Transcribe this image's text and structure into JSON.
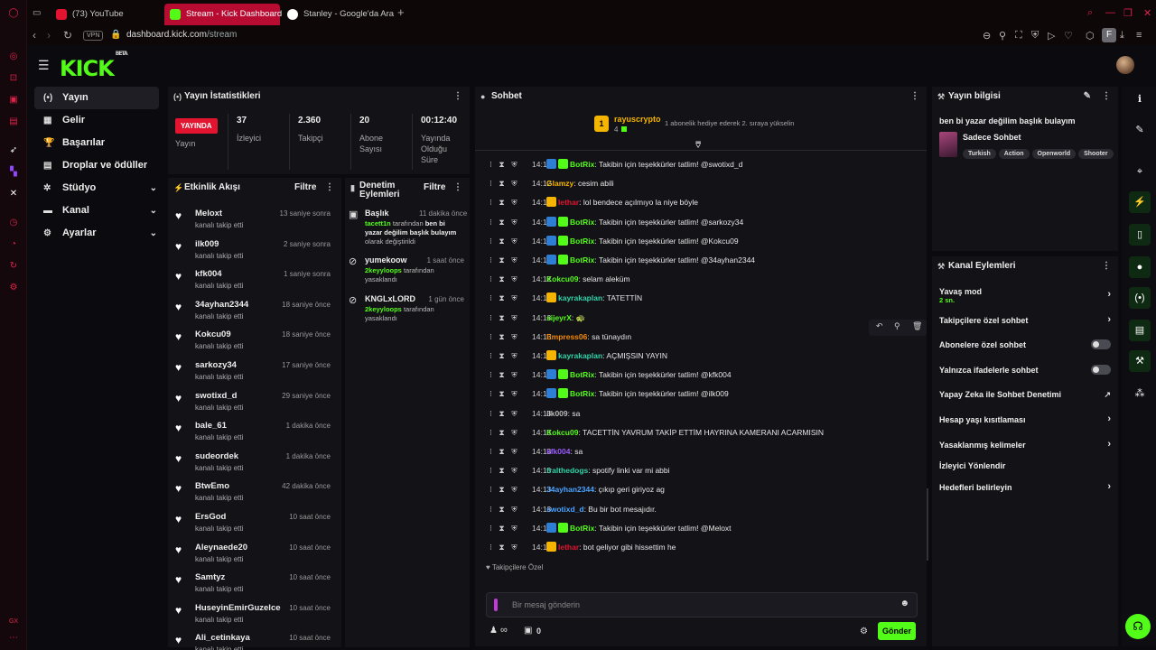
{
  "browser": {
    "tabs": [
      {
        "title": "(73) YouTube",
        "favicon": "youtube-icon"
      },
      {
        "title": "Stream - Kick Dashboard",
        "favicon": "kick-icon"
      },
      {
        "title": "Stanley - Google'da Ara",
        "favicon": "google-icon"
      }
    ],
    "vpn_label": "VPN",
    "url_host": "dashboard.kick.com",
    "url_path": "/stream",
    "profile_letter": "F",
    "accent": "#e0214a"
  },
  "app": {
    "logo": "KICK",
    "logo_sup": "BETA",
    "brand_color": "#53fc18"
  },
  "nav": {
    "items": [
      {
        "label": "Yayın",
        "icon": "stream-icon"
      },
      {
        "label": "Gelir",
        "icon": "revenue-icon"
      },
      {
        "label": "Başarılar",
        "icon": "trophy-icon"
      },
      {
        "label": "Droplar ve ödüller",
        "icon": "gift-icon"
      },
      {
        "label": "Stüdyo",
        "icon": "studio-icon"
      },
      {
        "label": "Kanal",
        "icon": "channel-icon"
      },
      {
        "label": "Ayarlar",
        "icon": "settings-icon"
      }
    ]
  },
  "stats": {
    "title": "Yayın İstatistikleri",
    "live_badge": "YAYINDA",
    "live_label": "Yayın",
    "items": [
      {
        "value": "37",
        "label": "İzleyici"
      },
      {
        "value": "2.360",
        "label": "Takipçi"
      },
      {
        "value": "20",
        "label": "Abone Sayısı"
      },
      {
        "value": "00:12:40",
        "label": "Yayında Olduğu Süre"
      }
    ]
  },
  "activity": {
    "title": "Etkinlik Akışı",
    "filter": "Filtre",
    "subtitle": "kanalı takip etti",
    "items": [
      {
        "name": "Meloxt",
        "time": "13 saniye sonra"
      },
      {
        "name": "ilk009",
        "time": "2 saniye sonra"
      },
      {
        "name": "kfk004",
        "time": "1 saniye sonra"
      },
      {
        "name": "34ayhan2344",
        "time": "18 saniye önce"
      },
      {
        "name": "Kokcu09",
        "time": "18 saniye önce"
      },
      {
        "name": "sarkozy34",
        "time": "17 saniye önce"
      },
      {
        "name": "swotixd_d",
        "time": "29 saniye önce"
      },
      {
        "name": "bale_61",
        "time": "1 dakika önce"
      },
      {
        "name": "sudeordek",
        "time": "1 dakika önce"
      },
      {
        "name": "BtwEmo",
        "time": "42 dakika önce"
      },
      {
        "name": "ErsGod",
        "time": "10 saat önce"
      },
      {
        "name": "Aleynaede20",
        "time": "10 saat önce"
      },
      {
        "name": "Samtyz",
        "time": "10 saat önce"
      },
      {
        "name": "HuseyinEmirGuzelce",
        "time": "10 saat önce"
      },
      {
        "name": "Ali_cetinkaya",
        "time": "10 saat önce"
      }
    ]
  },
  "moderation": {
    "title_line1": "Denetim",
    "title_line2": "Eylemleri",
    "filter": "Filtre",
    "items": [
      {
        "title": "Başlık",
        "time": "11 dakika önce",
        "actor": "tacett1n",
        "desc_a": " tarafından ",
        "desc_b": "ben bi yazar değilim başlık bulayım",
        "desc_c": " olarak değiştirildi"
      },
      {
        "title": "yumekoow",
        "time": "1 saat önce",
        "actor": "2keyyloops",
        "desc_a": " tarafından ",
        "desc_b": "",
        "desc_c": "yasaklandı"
      },
      {
        "title": "KNGLxLORD",
        "time": "1 gün önce",
        "actor": "2keyyloops",
        "desc_a": " tarafından ",
        "desc_b": "",
        "desc_c": "yasaklandı"
      }
    ]
  },
  "chat": {
    "title": "Sohbet",
    "pinned_user": "rayuscrypto",
    "pinned_count": "4",
    "pinned_rank": "1",
    "pinned_text": "1 abonelik hediye ederek 2. sıraya yükselin",
    "messages": [
      {
        "time": "14:12",
        "user": "BotRix",
        "color": "#53fc18",
        "badges": [
          "bot",
          "verified"
        ],
        "text": "Takibin için teşekkürler tatlim! @swotixd_d"
      },
      {
        "time": "14:12",
        "user": "Glamzy",
        "color": "#f5b400",
        "badges": [],
        "text": "cesim abili"
      },
      {
        "time": "14:12",
        "user": "lethar",
        "color": "#e3142f",
        "badges": [
          "crown"
        ],
        "text": "lol bendece açılmıyo la niye böyle"
      },
      {
        "time": "14:12",
        "user": "BotRix",
        "color": "#53fc18",
        "badges": [
          "bot",
          "verified"
        ],
        "text": "Takibin için teşekkürler tatlim! @sarkozy34"
      },
      {
        "time": "14:12",
        "user": "BotRix",
        "color": "#53fc18",
        "badges": [
          "bot",
          "verified"
        ],
        "text": "Takibin için teşekkürler tatlim! @Kokcu09"
      },
      {
        "time": "14:12",
        "user": "BotRix",
        "color": "#53fc18",
        "badges": [
          "bot",
          "verified"
        ],
        "text": "Takibin için teşekkürler tatlim! @34ayhan2344"
      },
      {
        "time": "14:12",
        "user": "Kokcu09",
        "color": "#53fc18",
        "badges": [],
        "text": "selam aleküm"
      },
      {
        "time": "14:13",
        "user": "kayrakaplan",
        "color": "#2fd3a8",
        "badges": [
          "crown"
        ],
        "text": "TATETTİN"
      },
      {
        "time": "14:13",
        "user": "sijeyrX",
        "color": "#53fc18",
        "badges": [],
        "text": "🐢"
      },
      {
        "time": "14:13",
        "user": "Empress06",
        "color": "#f58a00",
        "badges": [],
        "text": "sa tünaydın"
      },
      {
        "time": "14:13",
        "user": "kayrakaplan",
        "color": "#2fd3a8",
        "badges": [
          "crown"
        ],
        "text": "AÇMIŞSIN YAYIN"
      },
      {
        "time": "14:13",
        "user": "BotRix",
        "color": "#53fc18",
        "badges": [
          "bot",
          "verified"
        ],
        "text": "Takibin için teşekkürler tatlim! @kfk004"
      },
      {
        "time": "14:13",
        "user": "BotRix",
        "color": "#53fc18",
        "badges": [
          "bot",
          "verified"
        ],
        "text": "Takibin için teşekkürler tatlim! @ilk009"
      },
      {
        "time": "14:13",
        "user": "ilk009",
        "color": "#bbbbbb",
        "badges": [],
        "text": "sa"
      },
      {
        "time": "14:13",
        "user": "Kokcu09",
        "color": "#53fc18",
        "badges": [],
        "text": "TACETTİN YAVRUM TAKİP ETTİM HAYRINA KAMERANI ACARMISIN"
      },
      {
        "time": "14:13",
        "user": "kfk004",
        "color": "#9b59ff",
        "badges": [],
        "text": "sa"
      },
      {
        "time": "14:13",
        "user": "fralthedogs",
        "color": "#2fd3a8",
        "badges": [],
        "text": "spotify linki var mi abbi"
      },
      {
        "time": "14:13",
        "user": "34ayhan2344",
        "color": "#4aa3ff",
        "badges": [],
        "text": "çıkıp geri giriyoz ag"
      },
      {
        "time": "14:13",
        "user": "swotixd_d",
        "color": "#4aa3ff",
        "badges": [],
        "text": "Bu bir bot mesajıdır."
      },
      {
        "time": "14:13",
        "user": "BotRix",
        "color": "#53fc18",
        "badges": [
          "bot",
          "verified"
        ],
        "text": "Takibin için teşekkürler tatlim! @Meloxt"
      },
      {
        "time": "14:13",
        "user": "lethar",
        "color": "#e3142f",
        "badges": [
          "crown"
        ],
        "text": "bot geliyor gibi hissettim he"
      }
    ],
    "mode_label": "Takipçilere Özel",
    "input_placeholder": "Bir mesaj gönderin",
    "viewers_symbol": "∞",
    "points": "0",
    "send_label": "Gönder"
  },
  "stream_info": {
    "title": "Yayın bilgisi",
    "stream_title": "ben bi yazar değilim başlık bulayım",
    "category": "Sadece Sohbet",
    "tags": [
      "Turkish",
      "Action",
      "Openworld",
      "Shooter"
    ]
  },
  "channel_actions": {
    "title": "Kanal Eylemleri",
    "slow_mode": "Yavaş mod",
    "slow_value": "2 sn.",
    "items": [
      {
        "label": "Takipçilere özel sohbet",
        "control": "chevron"
      },
      {
        "label": "Abonelere özel sohbet",
        "control": "toggle"
      },
      {
        "label": "Yalnızca ifadelerle sohbet",
        "control": "toggle"
      },
      {
        "label": "Yapay Zeka ile Sohbet Denetimi",
        "control": "external"
      },
      {
        "label": "Hesap yaşı kısıtlaması",
        "control": "chevron"
      },
      {
        "label": "Yasaklanmış kelimeler",
        "control": "chevron"
      },
      {
        "label": "İzleyici Yönlendir",
        "control": "none"
      },
      {
        "label": "Hedefleri belirleyin",
        "control": "chevron"
      }
    ]
  }
}
